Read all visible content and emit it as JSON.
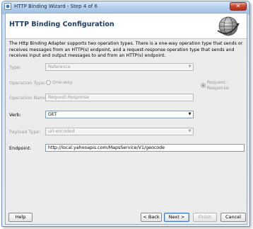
{
  "window": {
    "title": "HTTP Binding Wizard - Step 4 of 6",
    "close_glyph": "✕"
  },
  "header": {
    "title": "HTTP Binding Configuration"
  },
  "description": "The Http Binding Adapter supports two operation types.  There is a one-way operation type that sends or receives messages from an HTTP(s) endpoint, and a request-response operation type that sends and receives input and output messages to and from an HTTP(s) endpoint.",
  "form": {
    "type_label": "Type:",
    "type_value": "Reference",
    "operation_type_label": "Operation Type:",
    "one_way_label": "One-way",
    "request_response_label": "Request-Response",
    "operation_name_label": "Operation Name:",
    "operation_name_value": "Request-Response",
    "verb_label": "Verb:",
    "verb_value": "GET",
    "payload_type_label": "Payload Type:",
    "payload_type_value": "url-encoded",
    "endpoint_label": "Endpoint:",
    "endpoint_value": "http://local.yahooapis.com/MapsService/V1/geocode"
  },
  "buttons": {
    "help": "Help",
    "back": "< Back",
    "next": "Next >",
    "finish": "Finish",
    "cancel": "Cancel"
  },
  "icons": [
    "wizard-app-icon",
    "close-icon",
    "globe-icon",
    "dropdown-arrow-icon",
    "radio-icon"
  ]
}
